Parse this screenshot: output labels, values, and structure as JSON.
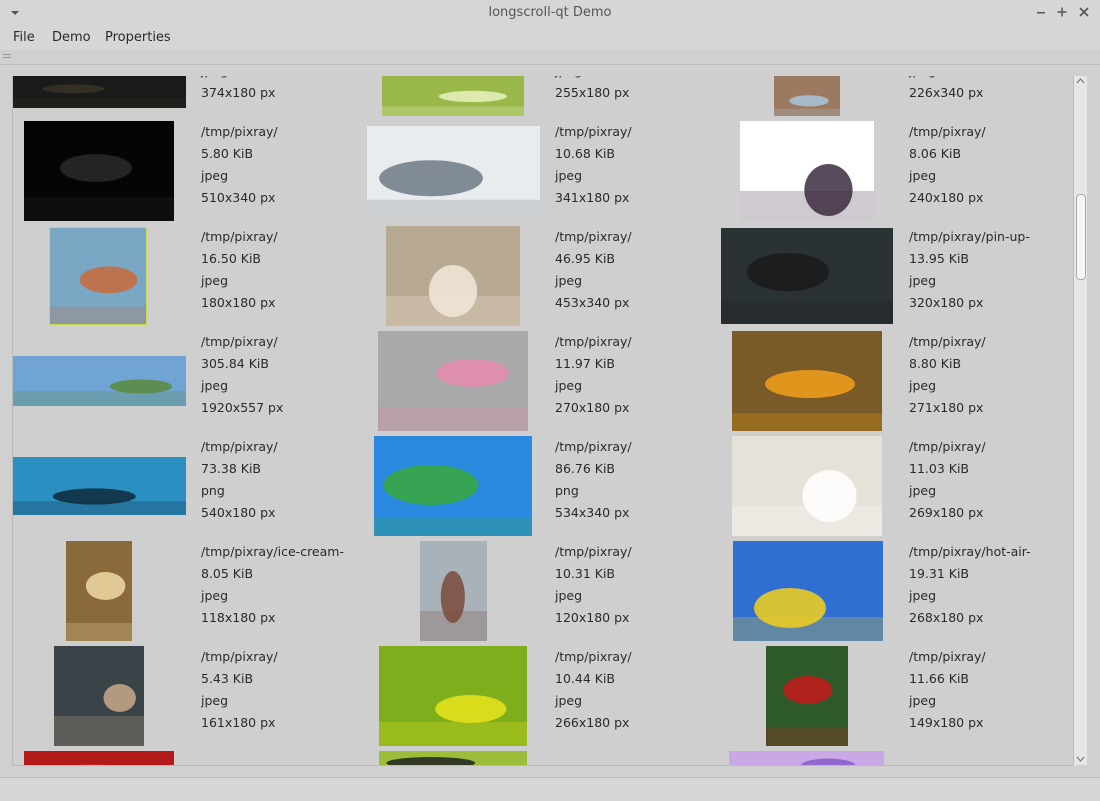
{
  "window": {
    "title": "longscroll-qt Demo"
  },
  "menu": [
    "File",
    "Demo",
    "Properties"
  ],
  "rows": [
    [
      {
        "path": "",
        "size": "",
        "type": "jpeg",
        "dims": "374x180 px",
        "thumb": {
          "fill": "#1a1a1a",
          "accent": "#3a3328"
        }
      },
      {
        "path": "",
        "size": "",
        "type": "jpeg",
        "dims": "255x180 px",
        "thumb": {
          "fill": "#9ab84a",
          "accent": "#e7f2c0"
        }
      },
      {
        "path": "",
        "size": "",
        "type": "jpeg",
        "dims": "226x340 px",
        "thumb": {
          "fill": "#9c7a62",
          "accent": "#a7c4d8"
        }
      }
    ],
    [
      {
        "path": "/tmp/pixray/",
        "size": "5.80 KiB",
        "type": "jpeg",
        "dims": "510x340 px",
        "thumb": {
          "fill": "#050505",
          "accent": "#2a2a2a"
        }
      },
      {
        "path": "/tmp/pixray/",
        "size": "10.68 KiB",
        "type": "jpeg",
        "dims": "341x180 px",
        "thumb": {
          "fill": "#e9ecee",
          "accent": "#6f7a85"
        }
      },
      {
        "path": "/tmp/pixray/",
        "size": "8.06 KiB",
        "type": "jpeg",
        "dims": "240x180 px",
        "thumb": {
          "fill": "#ffffff",
          "accent": "#3b2b3e"
        }
      }
    ],
    [
      {
        "path": "/tmp/pixray/",
        "size": "16.50 KiB",
        "type": "jpeg",
        "dims": "180x180 px",
        "thumb": {
          "fill": "#7aa7c4",
          "accent": "#c96a3a"
        }
      },
      {
        "path": "/tmp/pixray/",
        "size": "46.95 KiB",
        "type": "jpeg",
        "dims": "453x340 px",
        "thumb": {
          "fill": "#b8aa92",
          "accent": "#f2e8d8"
        }
      },
      {
        "path": "/tmp/pixray/pin-up-",
        "size": "13.95 KiB",
        "type": "jpeg",
        "dims": "320x180 px",
        "thumb": {
          "fill": "#2b3236",
          "accent": "#1a1a1a"
        }
      }
    ],
    [
      {
        "path": "/tmp/pixray/",
        "size": "305.84 KiB",
        "type": "jpeg",
        "dims": "1920x557 px",
        "thumb": {
          "fill": "#6fa4d4",
          "accent": "#5b8a3a"
        }
      },
      {
        "path": "/tmp/pixray/",
        "size": "11.97 KiB",
        "type": "jpeg",
        "dims": "270x180 px",
        "thumb": {
          "fill": "#a9a9a9",
          "accent": "#e889b0"
        }
      },
      {
        "path": "/tmp/pixray/",
        "size": "8.80 KiB",
        "type": "jpeg",
        "dims": "271x180 px",
        "thumb": {
          "fill": "#7a5a26",
          "accent": "#f2a11c"
        }
      }
    ],
    [
      {
        "path": "/tmp/pixray/",
        "size": "73.38 KiB",
        "type": "png",
        "dims": "540x180 px",
        "thumb": {
          "fill": "#2b8fc2",
          "accent": "#0f2a3b"
        }
      },
      {
        "path": "/tmp/pixray/",
        "size": "86.76 KiB",
        "type": "png",
        "dims": "534x340 px",
        "thumb": {
          "fill": "#2a8ae0",
          "accent": "#3aa83a"
        }
      },
      {
        "path": "/tmp/pixray/",
        "size": "11.03 KiB",
        "type": "jpeg",
        "dims": "269x180 px",
        "thumb": {
          "fill": "#e6e2da",
          "accent": "#ffffff"
        }
      }
    ],
    [
      {
        "path": "/tmp/pixray/ice-cream-",
        "size": "8.05 KiB",
        "type": "jpeg",
        "dims": "118x180 px",
        "thumb": {
          "fill": "#8a6a3a",
          "accent": "#f0d9a6"
        }
      },
      {
        "path": "/tmp/pixray/",
        "size": "10.31 KiB",
        "type": "jpeg",
        "dims": "120x180 px",
        "thumb": {
          "fill": "#a9b2b8",
          "accent": "#7a4a3a"
        }
      },
      {
        "path": "/tmp/pixray/hot-air-",
        "size": "19.31 KiB",
        "type": "jpeg",
        "dims": "268x180 px",
        "thumb": {
          "fill": "#2f6fd1",
          "accent": "#f4d01a"
        }
      }
    ],
    [
      {
        "path": "/tmp/pixray/",
        "size": "5.43 KiB",
        "type": "jpeg",
        "dims": "161x180 px",
        "thumb": {
          "fill": "#3a4448",
          "accent": "#c9a88a"
        }
      },
      {
        "path": "/tmp/pixray/",
        "size": "10.44 KiB",
        "type": "jpeg",
        "dims": "266x180 px",
        "thumb": {
          "fill": "#7fae1c",
          "accent": "#e8e41a"
        }
      },
      {
        "path": "/tmp/pixray/",
        "size": "11.66 KiB",
        "type": "jpeg",
        "dims": "149x180 px",
        "thumb": {
          "fill": "#2f5a2a",
          "accent": "#c71a1a"
        }
      }
    ],
    [
      {
        "path": "",
        "size": "",
        "type": "",
        "dims": "",
        "thumb": {
          "fill": "#b21a1a",
          "accent": "#e04a4a"
        }
      },
      {
        "path": "",
        "size": "",
        "type": "",
        "dims": "",
        "thumb": {
          "fill": "#9cbd3a",
          "accent": "#222222"
        }
      },
      {
        "path": "",
        "size": "",
        "type": "",
        "dims": "",
        "thumb": {
          "fill": "#c9a8e6",
          "accent": "#8a5ac9"
        }
      }
    ]
  ]
}
